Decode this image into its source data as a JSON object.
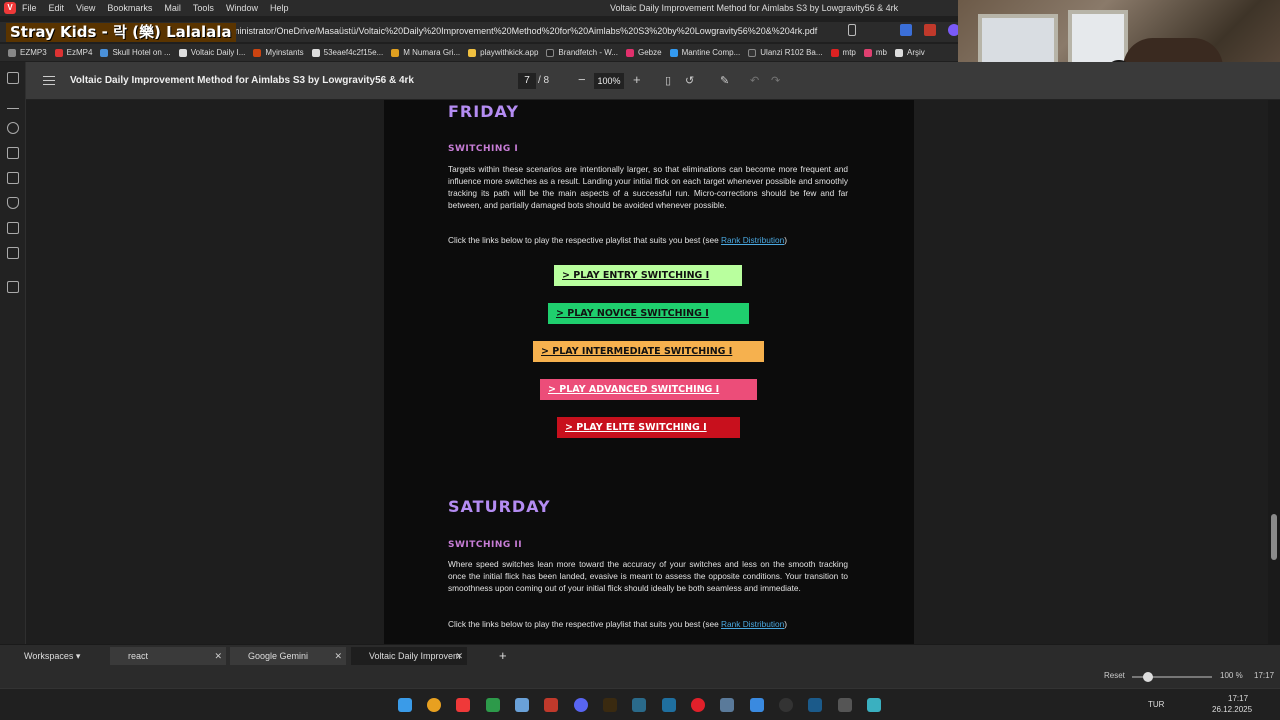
{
  "menu": [
    "File",
    "Edit",
    "View",
    "Bookmarks",
    "Mail",
    "Tools",
    "Window",
    "Help"
  ],
  "window_title": "Voltaic Daily Improvement Method for Aimlabs S3 by Lowgravity56 & 4rk",
  "overlay_title": "Stray Kids - 락 (樂) Lalalala",
  "url": "s/Administrator/OneDrive/Masaüstü/Voltaic%20Daily%20Improvement%20Method%20for%20Aimlabs%20S3%20by%20Lowgravity56%20&%204rk.pdf",
  "bookmarks": [
    "EZMP3",
    "EzMP4",
    "Skull Hotel on ...",
    "Voltaic Daily I...",
    "Myinstants",
    "53eaef4c2f15e...",
    "M Numara Gri...",
    "playwithkick.app",
    "Brandfetch - W...",
    "Gebze",
    "Mantine Comp...",
    "Ulanzi R102 Ba...",
    "mtp",
    "mb",
    "Arşiv"
  ],
  "pdf": {
    "title": "Voltaic Daily Improvement Method for Aimlabs S3 by Lowgravity56 & 4rk",
    "page_current": "7",
    "page_total": "/  8",
    "zoom": "100%"
  },
  "friday": {
    "day": "FRIDAY",
    "section": "SWITCHING I",
    "para": "Targets within these scenarios are intentionally larger, so that eliminations can become more frequent and influence more switches as a result. Landing your initial flick on each target whenever possible and smoothly tracking its path will be the main aspects of a successful run. Micro-corrections should be few and far between, and partially damaged bots should be avoided whenever possible.",
    "links_text": "Click the links below to play the respective playlist that suits you best (see ",
    "rank_link": "Rank Distribution",
    "close_paren": ")",
    "buttons": [
      {
        "label": "> PLAY ENTRY SWITCHING I",
        "color": "#b9ff9e"
      },
      {
        "label": "> PLAY NOVICE SWITCHING I",
        "color": "#1fcf6e"
      },
      {
        "label": "> PLAY INTERMEDIATE SWITCHING I",
        "color": "#f6b14e"
      },
      {
        "label": "> PLAY ADVANCED SWITCHING I",
        "color": "#ec4d79"
      },
      {
        "label": "> PLAY ELITE SWITCHING I",
        "color": "#c8101d"
      }
    ]
  },
  "saturday": {
    "day": "SATURDAY",
    "section": "SWITCHING II",
    "para": "Where speed switches lean more toward the accuracy of your switches and less on the smooth tracking once the initial flick has been landed, evasive is meant to assess the opposite conditions. Your transition to smoothness upon coming out of your initial flick should ideally be both seamless and immediate.",
    "links_text": "Click the links below to play the respective playlist that suits you best (see ",
    "rank_link": "Rank Distribution",
    "close_paren": ")"
  },
  "tabs": {
    "workspaces": "Workspaces",
    "items": [
      "react",
      "Google Gemini",
      "Voltaic Daily Improvem"
    ]
  },
  "status": {
    "reset": "Reset",
    "zoom": "100 %",
    "time": "17:17"
  },
  "taskbar": {
    "lang": "TUR",
    "time": "17:17",
    "date": "26.12.2025"
  }
}
